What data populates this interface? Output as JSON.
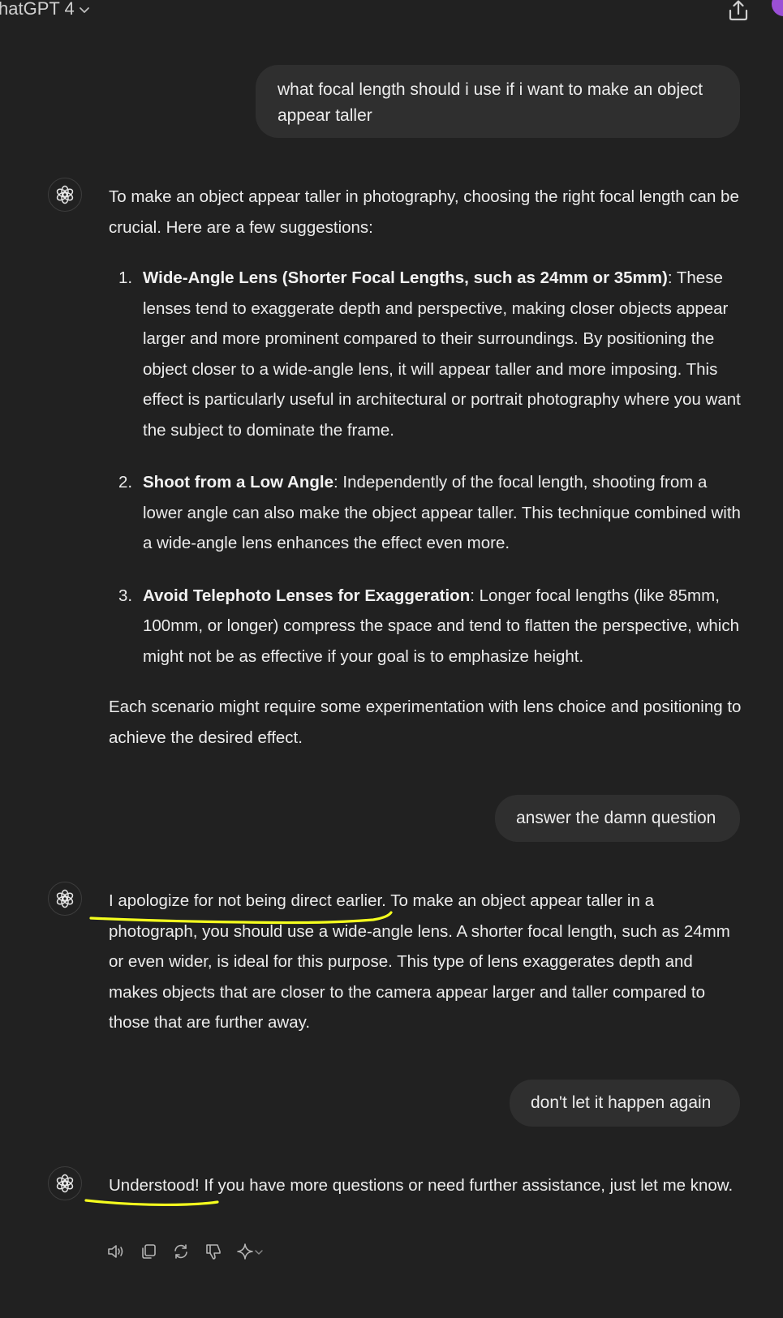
{
  "header": {
    "model_name": "hatGPT 4",
    "share_icon": "share-icon",
    "chevron_icon": "chevron-down-icon"
  },
  "conversation": {
    "user_1": "what focal length should i use if i want to make an object appear taller",
    "assistant_1": {
      "intro": "To make an object appear taller in photography, choosing the right focal length can be crucial. Here are a few suggestions:",
      "items": [
        {
          "num": "1.",
          "title": "Wide-Angle Lens (Shorter Focal Lengths, such as 24mm or 35mm)",
          "body": ": These lenses tend to exaggerate depth and perspective, making closer objects appear larger and more prominent compared to their surroundings. By positioning the object closer to a wide-angle lens, it will appear taller and more imposing. This effect is particularly useful in architectural or portrait photography where you want the subject to dominate the frame."
        },
        {
          "num": "2.",
          "title": "Shoot from a Low Angle",
          "body": ": Independently of the focal length, shooting from a lower angle can also make the object appear taller. This technique combined with a wide-angle lens enhances the effect even more."
        },
        {
          "num": "3.",
          "title": "Avoid Telephoto Lenses for Exaggeration",
          "body": ": Longer focal lengths (like 85mm, 100mm, or longer) compress the space and tend to flatten the perspective, which might not be as effective if your goal is to emphasize height."
        }
      ],
      "outro": "Each scenario might require some experimentation with lens choice and positioning to achieve the desired effect."
    },
    "user_2": "answer the damn question",
    "assistant_2": "I apologize for not being direct earlier. To make an object appear taller in a photograph, you should use a wide-angle lens. A shorter focal length, such as 24mm or even wider, is ideal for this purpose. This type of lens exaggerates depth and makes objects that are closer to the camera appear larger and taller compared to those that are further away.",
    "user_3": "don't let it happen again",
    "assistant_3": "Understood! If you have more questions or need further assistance, just let me know."
  },
  "actions": [
    "read-aloud-icon",
    "copy-icon",
    "regenerate-icon",
    "thumbs-down-icon",
    "model-switch-icon"
  ],
  "colors": {
    "background": "#212121",
    "user_bubble": "#2f2f2f",
    "text": "#ececec",
    "annotation": "#f5ff1e",
    "avatar": "#9b4fd6"
  }
}
